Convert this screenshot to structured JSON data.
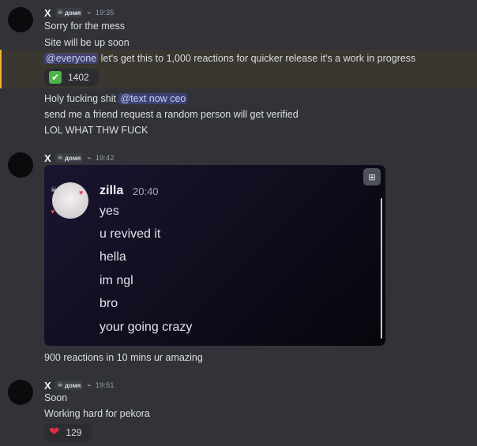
{
  "messages": [
    {
      "username": "X",
      "server_tag": "домя",
      "timestamp": "19:35",
      "lines": [
        "Sorry for the mess",
        "Site will be up soon"
      ]
    },
    {
      "highlight_mention": "@everyone",
      "highlight_text": " let's get this to 1,000 reactions for quicker release it's a work in progress",
      "reaction": {
        "emoji": "✅",
        "count": "1402"
      }
    },
    {
      "line1_text": "Holy fucking shit ",
      "line1_mention": "@text now ceo",
      "line2": "send me a friend request a random person will get verified",
      "line3": "LOL WHAT THW FUCK"
    },
    {
      "username": "X",
      "server_tag": "домя",
      "timestamp": "19:42",
      "embed": {
        "name": "zilla",
        "time": "20:40",
        "lines": [
          "yes",
          "u revived it",
          "hella",
          "im ngl",
          "bro",
          "your going crazy"
        ]
      },
      "after_embed": "900 reactions in 10 mins ur amazing"
    },
    {
      "username": "X",
      "server_tag": "домя",
      "timestamp": "19:51",
      "lines": [
        "Soon",
        "Working hard for pekora"
      ],
      "reaction": {
        "emoji": "❤",
        "count": "129"
      }
    }
  ]
}
